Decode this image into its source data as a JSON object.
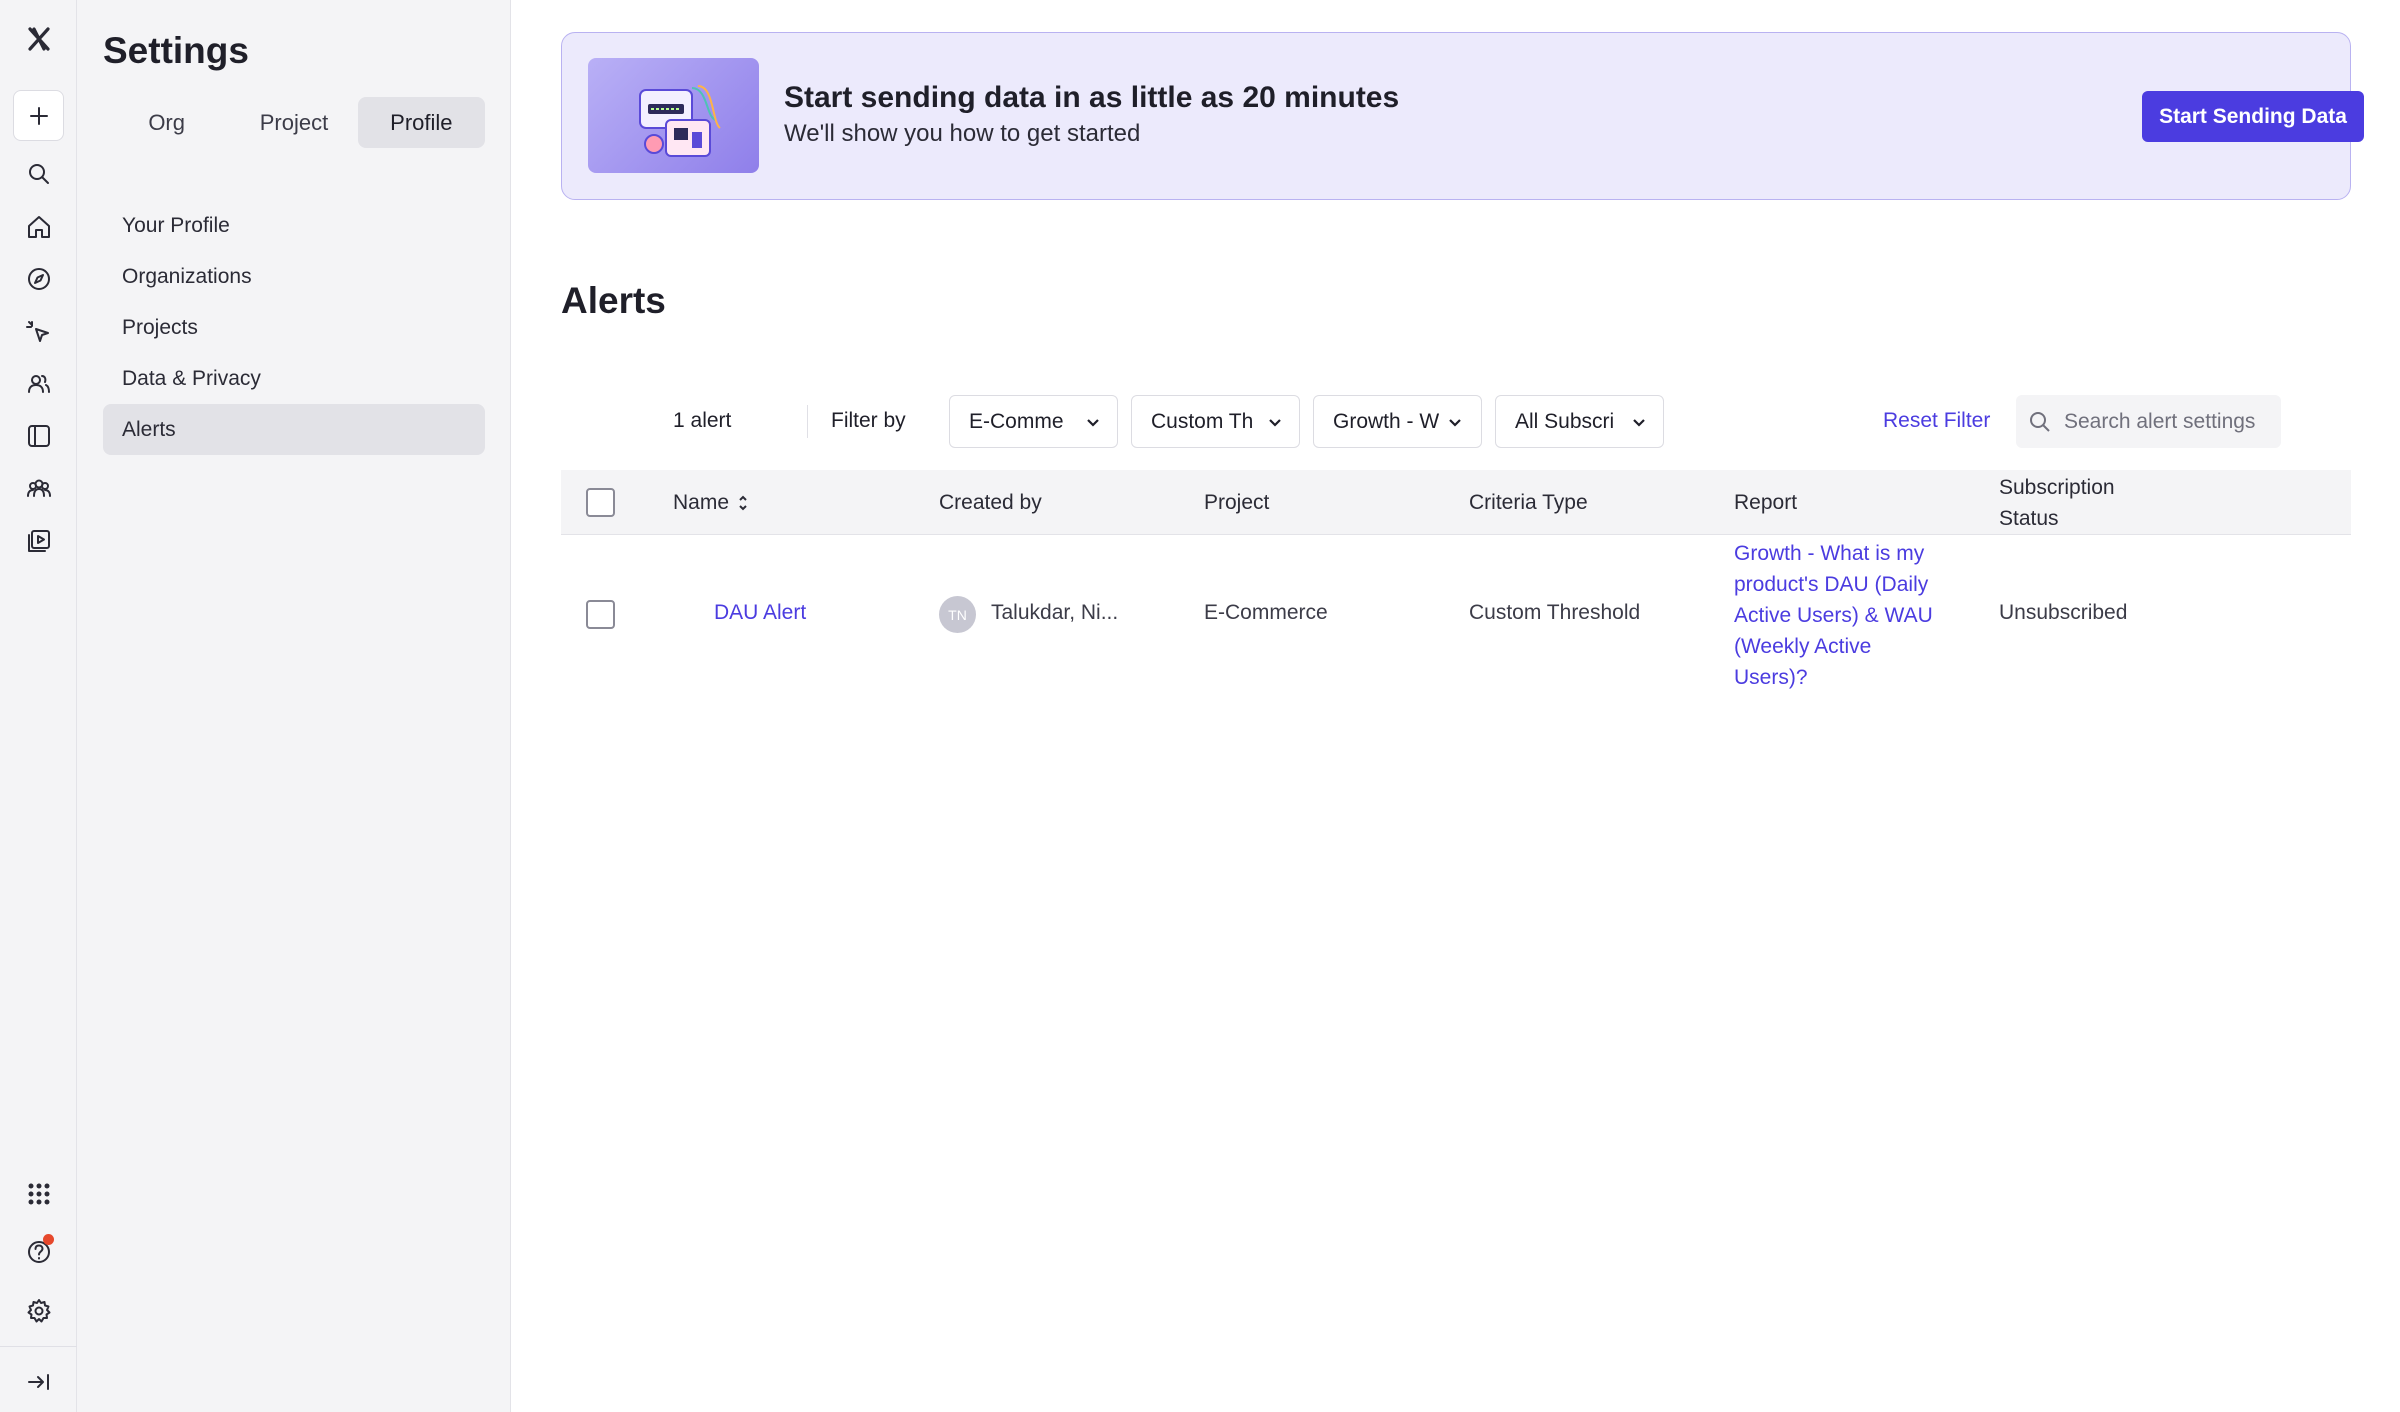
{
  "rail": {
    "items": [
      "logo",
      "create",
      "search",
      "home",
      "discover",
      "session-replay",
      "users",
      "boards",
      "cohorts",
      "media"
    ],
    "bottom_items": [
      "apps",
      "help",
      "settings",
      "collapse"
    ]
  },
  "settings": {
    "title": "Settings",
    "tabs": [
      {
        "label": "Org",
        "active": false
      },
      {
        "label": "Project",
        "active": false
      },
      {
        "label": "Profile",
        "active": true
      }
    ],
    "nav": [
      {
        "label": "Your Profile",
        "active": false
      },
      {
        "label": "Organizations",
        "active": false
      },
      {
        "label": "Projects",
        "active": false
      },
      {
        "label": "Data & Privacy",
        "active": false
      },
      {
        "label": "Alerts",
        "active": true
      }
    ]
  },
  "banner": {
    "headline": "Start sending data in as little as 20 minutes",
    "subtext": "We'll show you how to get started",
    "cta": "Start Sending Data"
  },
  "page": {
    "title": "Alerts"
  },
  "toolbar": {
    "count": "1 alert",
    "filter_label": "Filter by",
    "filters": [
      "E-Comme",
      "Custom Th",
      "Growth - W",
      "All Subscri"
    ],
    "reset": "Reset Filter",
    "search_placeholder": "Search alert settings"
  },
  "table": {
    "headers": {
      "name": "Name",
      "created_by": "Created by",
      "project": "Project",
      "criteria_type": "Criteria Type",
      "report": "Report",
      "subscription_status_line1": "Subscription",
      "subscription_status_line2": "Status"
    },
    "rows": [
      {
        "name": "DAU Alert",
        "avatar_initials": "TN",
        "created_by": "Talukdar, Ni...",
        "project": "E-Commerce",
        "criteria_type": "Custom Threshold",
        "report": "Growth - What is my product's DAU (Daily Active Users) & WAU (Weekly Active Users)?",
        "subscription_status": "Unsubscribed"
      }
    ]
  },
  "colors": {
    "accent": "#4b3ce0",
    "banner_bg": "#eceafc",
    "notification": "#e6482c"
  }
}
